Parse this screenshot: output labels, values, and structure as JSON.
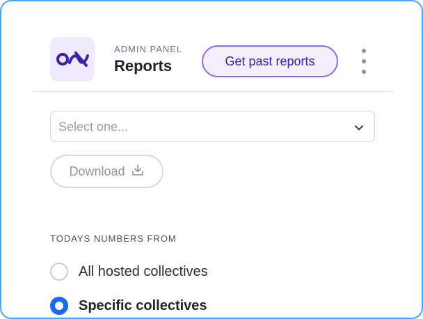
{
  "header": {
    "kicker": "ADMIN PANEL",
    "title": "Reports",
    "past_reports_label": "Get past reports",
    "logo_icon": "opencollective-logo-icon",
    "more_icon": "kebab-menu-icon"
  },
  "report_select": {
    "placeholder": "Select one...",
    "chevron_icon": "chevron-down-icon"
  },
  "download": {
    "label": "Download",
    "icon": "download-icon"
  },
  "numbers": {
    "section_label": "TODAYS NUMBERS FROM",
    "options": [
      {
        "label": "All hosted collectives",
        "selected": false
      },
      {
        "label": "Specific collectives",
        "selected": true
      }
    ]
  },
  "colors": {
    "accent": "#8b6cf0",
    "radio_selected": "#1869f5",
    "frame_border": "#4aa3f0"
  }
}
